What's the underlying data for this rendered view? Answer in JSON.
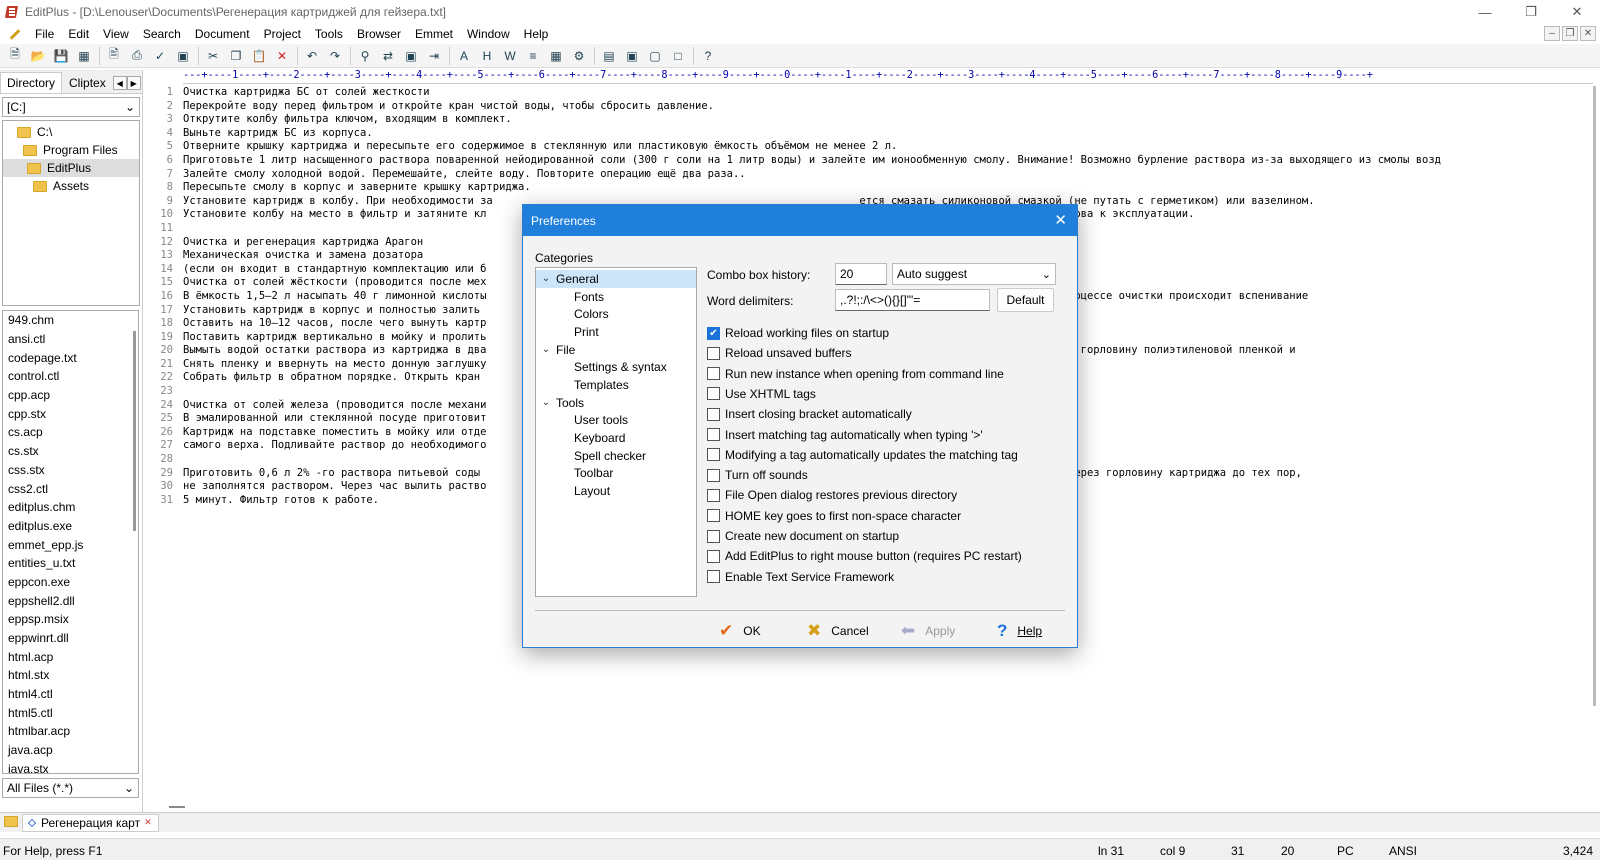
{
  "window": {
    "title": "EditPlus - [D:\\Lenouser\\Documents\\Регенерация картриджей для гейзера.txt]"
  },
  "menu": [
    "File",
    "Edit",
    "View",
    "Search",
    "Document",
    "Project",
    "Tools",
    "Browser",
    "Emmet",
    "Window",
    "Help"
  ],
  "left_panel": {
    "tabs": [
      "Directory",
      "Cliptex"
    ],
    "drive": "[C:]",
    "tree": [
      "C:\\",
      "Program Files",
      "EditPlus",
      "Assets"
    ],
    "files": [
      "949.chm",
      "ansi.ctl",
      "codepage.txt",
      "control.ctl",
      "cpp.acp",
      "cpp.stx",
      "cs.acp",
      "cs.stx",
      "css.stx",
      "css2.ctl",
      "editplus.chm",
      "editplus.exe",
      "emmet_epp.js",
      "entities_u.txt",
      "eppcon.exe",
      "eppshell2.dll",
      "eppsp.msix",
      "eppwinrt.dll",
      "html.acp",
      "html.stx",
      "html4.ctl",
      "html5.ctl",
      "htmlbar.acp",
      "java.acp",
      "java.stx"
    ],
    "filter": "All Files (*.*)"
  },
  "editor": {
    "ruler": "---+----1----+----2----+----3----+----4----+----5----+----6----+----7----+----8----+----9----+----0----+----1----+----2----+----3----+----4----+----5----+----6----+----7----+----8----+----9----+",
    "lines": [
      "Очистка картриджа БС от солей жесткости",
      "Перекройте воду перед фильтром и откройте кран чистой воды, чтобы сбросить давление.",
      "Открутите колбу фильтра ключом, входящим в комплект.",
      "Выньте картридж БС из корпуса.",
      "Отверните крышку картриджа и пересыпьте его содержимое в стеклянную или пластиковую ёмкость объёмом не менее 2 л.",
      "Приготовьте 1 литр насыщенного раствора поваренной нейодированной соли (300 г соли на 1 литр воды) и залейте им ионообменную смолу. Внимание! Возможно бурление раствора из-за выходящего из смолы возд",
      "Залейте смолу холодной водой. Перемешайте, слейте воду. Повторите операцию ещё два раза..",
      "Пересыпьте смолу в корпус и заверните крышку картриджа.",
      "Установите картридж в колбу. При необходимости за                                                          ется смазать силиконовой смазкой (не путать с герметиком) или вазелином.",
      "Установите колбу на место в фильтр и затяните кл                                                          льтр в течении 2-5 мин. Система готова к эксплуатации.",
      "",
      "Очистка и регенерация картриджа Арагон",
      "Механическая очистка и замена дозатора",
      "(если он входит в стандартную комплектацию или б",
      "Очистка от солей жёсткости (проводится после мех",
      "В ёмкость 1,5–2 л насыпать 40 г лимонной кислоты                                                          з несколько приемов, поскольку в процессе очистки происходит вспенивание",
      "Установить картридж в корпус и полностью залить",
      "Оставить на 10–12 часов, после чего вынуть картр",
      "Поставить картридж вертикально в мойку и пролить                                                          полностью стечь.",
      "Вымыть водой остатки раствора из картриджа в два                                                          резьбовую горловину. Затем обернуть горловину полиэтиленовой пленкой и",
      "Снять пленку и ввернуть на место донную заглушку",
      "Собрать фильтр в обратном порядке. Открыть кран                                                           .",
      "",
      "Очистка от солей железа (проводится после механи",
      "В эмалированной или стеклянной посуде приготовит                                                          на литр воды).",
      "Картридж на подставке поместить в мойку или отде                                                          горловину) до",
      "самого верха. Подливайте раствор до необходимого                                                          розрачной.",
      "",
      "Приготовить 0,6 л 2% -го раствора питьевой соды                                                           твор соды. Заливать раствор нужно через горловину картриджа до тех пор,",
      "не заполнятся раствором. Через час вылить раство                                                          в течение",
      "5 минут. Фильтр готов к работе."
    ]
  },
  "doc_tab": "Регенерация карт",
  "status": {
    "help": "For Help, press F1",
    "ln": "ln 31",
    "col": "col 9",
    "v1": "31",
    "v2": "20",
    "mode": "PC",
    "encoding": "ANSI",
    "size": "3,424"
  },
  "dialog": {
    "title": "Preferences",
    "categories_label": "Categories",
    "categories": [
      {
        "label": "General",
        "level": 0,
        "expanded": true,
        "selected": true
      },
      {
        "label": "Fonts",
        "level": 1
      },
      {
        "label": "Colors",
        "level": 1
      },
      {
        "label": "Print",
        "level": 1
      },
      {
        "label": "File",
        "level": 0,
        "expanded": true
      },
      {
        "label": "Settings & syntax",
        "level": 1
      },
      {
        "label": "Templates",
        "level": 1
      },
      {
        "label": "Tools",
        "level": 0,
        "expanded": true
      },
      {
        "label": "User tools",
        "level": 1
      },
      {
        "label": "Keyboard",
        "level": 1
      },
      {
        "label": "Spell checker",
        "level": 1
      },
      {
        "label": "Toolbar",
        "level": 1
      },
      {
        "label": "Layout",
        "level": 1
      }
    ],
    "combo_history_label": "Combo box history:",
    "combo_history_value": "20",
    "auto_suggest": "Auto suggest",
    "word_delim_label": "Word delimiters:",
    "word_delim_value": ",.?!;:/\\<>(){}[]\"'=",
    "default_button": "Default",
    "options": [
      {
        "label": "Reload working files on startup",
        "checked": true
      },
      {
        "label": "Reload unsaved buffers",
        "checked": false
      },
      {
        "label": "Run new instance when opening from command line",
        "checked": false
      },
      {
        "label": "Use XHTML tags",
        "checked": false
      },
      {
        "label": "Insert closing bracket automatically",
        "checked": false
      },
      {
        "label": "Insert matching tag automatically when typing '>'",
        "checked": false
      },
      {
        "label": "Modifying a tag automatically updates the matching tag",
        "checked": false
      },
      {
        "label": "Turn off sounds",
        "checked": false
      },
      {
        "label": "File Open dialog restores previous directory",
        "checked": false
      },
      {
        "label": "HOME key goes to first non-space character",
        "checked": false
      },
      {
        "label": "Create new document on startup",
        "checked": false
      },
      {
        "label": "Add EditPlus to right mouse button (requires PC restart)",
        "checked": false
      },
      {
        "label": "Enable Text Service Framework",
        "checked": false
      }
    ],
    "buttons": {
      "ok": "OK",
      "cancel": "Cancel",
      "apply": "Apply",
      "help": "Help"
    }
  }
}
